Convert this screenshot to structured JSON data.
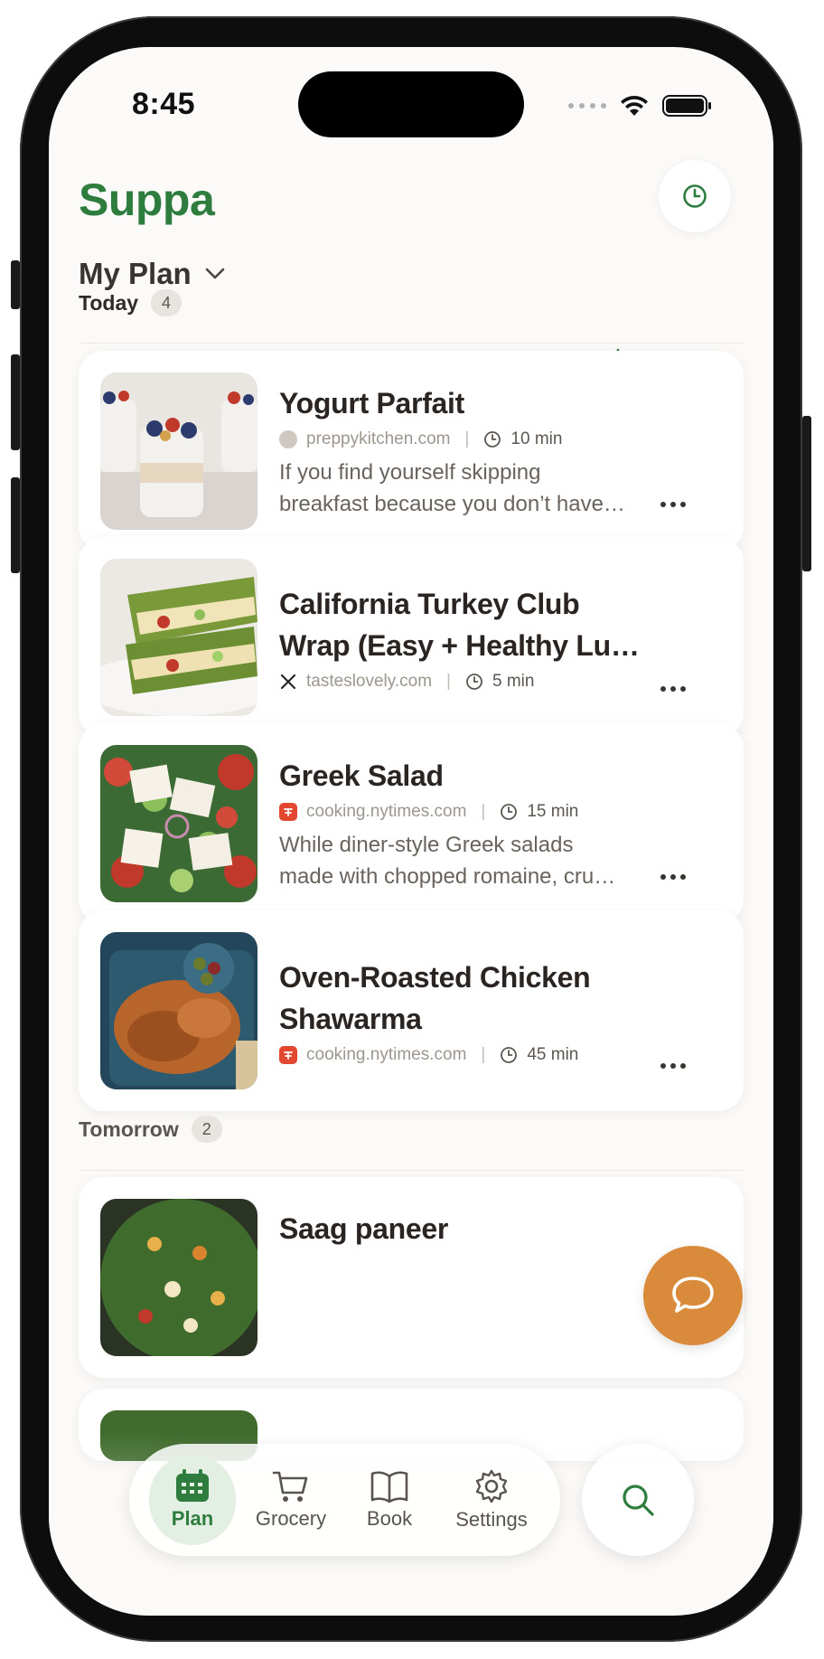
{
  "status_bar": {
    "time": "8:45"
  },
  "header": {
    "app_title": "Suppa",
    "plan_name": "My Plan"
  },
  "colors": {
    "brand": "#2e7d3e",
    "accent_orange": "#d98a3a",
    "nyt_red": "#e2472f"
  },
  "sections": {
    "today": {
      "label": "Today",
      "count": "4"
    },
    "tomorrow": {
      "label": "Tomorrow",
      "count": "2"
    }
  },
  "recipes": [
    {
      "title": "Yogurt Parfait",
      "source": "preppykitchen.com",
      "time": "10 min",
      "description": "If you find yourself skipping",
      "description2": "breakfast because you don’t have…",
      "source_icon": "avatar-icon"
    },
    {
      "title": "California Turkey Club",
      "title2": "Wrap (Easy + Healthy Lu…",
      "source": "tasteslovely.com",
      "time": "5 min",
      "source_icon": "utensils-icon"
    },
    {
      "title": "Greek Salad",
      "source": "cooking.nytimes.com",
      "time": "15 min",
      "description": "While diner-style Greek salads",
      "description2": "made with chopped romaine, cru…",
      "source_icon": "nyt-icon"
    },
    {
      "title": "Oven-Roasted Chicken",
      "title2": "Shawarma",
      "source": "cooking.nytimes.com",
      "time": "45 min",
      "source_icon": "nyt-icon"
    },
    {
      "title": "Saag paneer"
    }
  ],
  "tabbar": {
    "plan": "Plan",
    "grocery": "Grocery",
    "book": "Book",
    "settings": "Settings"
  }
}
